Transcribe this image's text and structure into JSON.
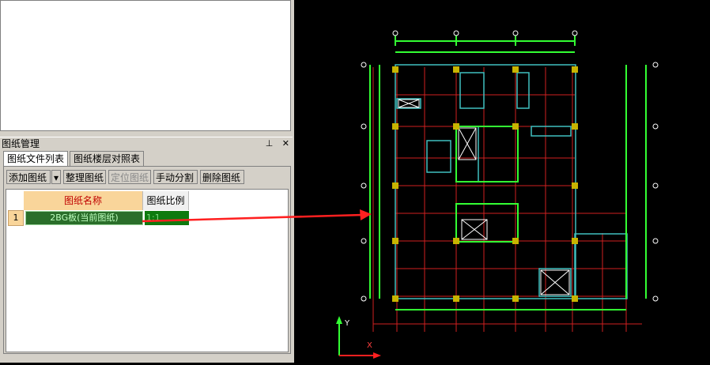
{
  "panel": {
    "title": "图纸管理",
    "pin": "⊥",
    "close": "✕"
  },
  "tabs": [
    "图纸文件列表",
    "图纸楼层对照表"
  ],
  "toolbar": {
    "add": "添加图纸",
    "dropdown": "▾",
    "arrange": "整理图纸",
    "locate": "定位图纸",
    "split": "手动分割",
    "delete": "删除图纸"
  },
  "table": {
    "headers": [
      "图纸名称",
      "图纸比例"
    ],
    "rows": [
      {
        "index": "1",
        "name": "2BG板(当前图纸)",
        "scale": "1:1"
      }
    ]
  },
  "colors": {
    "selection": "#2a6e2a",
    "header_highlight": "#f9d59a",
    "arrow": "#ff2020",
    "cad_line": "#33ff33",
    "cad_grid": "#d02020",
    "cad_beam": "#40c0c0"
  },
  "cad": {
    "axis_y": "Y",
    "axis_x": "X"
  }
}
